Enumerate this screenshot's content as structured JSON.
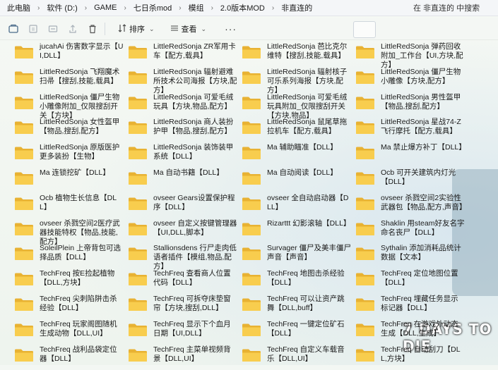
{
  "address_bar": {
    "crumbs": [
      "此电脑",
      "软件 (D:)",
      "GAME",
      "七日杀mod",
      "模组",
      "2.0版本MOD",
      "非直连的"
    ],
    "search_placeholder": "在 非直连的 中搜索"
  },
  "toolbar": {
    "sort_label": "排序",
    "view_label": "查看",
    "more_label": "···"
  },
  "background": {
    "logo_text": "7 DAYS TO DIE"
  },
  "folders": [
    "jucahAi 伤害数字显示【UI,DLL】",
    "LittleRedSonja ZR军用卡车【配方,载具】",
    "LittleRedSonja 芭比克尔维特【搜刮,技能,载具】",
    "LittleRedSonja 弹药回收附加_工作台【UI,方块,配方】",
    "LittleRedSonja 飞翔魔术扫帚【搜刮,技能,载具】",
    "LittleRedSonja 辐射避难所技术公司海报【方块,配方】",
    "LittleRedSonja 辐射核子可乐系列海报【方块,配方】",
    "LittleRedSonja 僵尸生物小雕像【方块,配方】",
    "LittleRedSonja 僵尸生物小雕像附加_仅限搜刮开关【方块】",
    "LittleRedSonja 可爱毛绒玩具【方块,物品,配方】",
    "LittleRedSonja 可爱毛绒玩具附加_仅限搜刮开关【方块,物品】",
    "LittleRedSonja 男性盔甲【物品,搜刮,配方】",
    "LittleRedSonja 女性盔甲【物品,搜刮,配方】",
    "LittleRedSonja 商人装扮护甲【物品,搜刮,配方】",
    "LittleRedSonja 鼠尾草拖拉机车【配方,载具】",
    "LittleRedSonja 星战74-Z飞行摩托【配方,载具】",
    "LittleRedSonja 原版医护更多装扮【生物】",
    "LittleRedSonja 装饰装甲系统【DLL】",
    "Ma 辅助瞄准【DLL】",
    "Ma 禁止爆方补丁【DLL】",
    "Ma 连锁挖矿【DLL】",
    "Ma 自动书籍【DLL】",
    "Ma 自动阅读【DLL】",
    "Ocb 可开关建筑内灯光【DLL】",
    "Ocb 植物生长信息【DLL】",
    "ovseer Gears设置保护程序【DLL】",
    "ovseer 全自动启动器【DLL】",
    "ovseer 杀戮空间2实验性武器包【物品,配方,声音】",
    "ovseer 杀戮空间2医疗武器技能特权【物品,技能,配方】",
    "ovseer 自定义按键管理器【UI,DLL,脚本】",
    "Rizarttt 幻影滚轴【DLL】",
    "Shaklin 用steam好友名字命名丧尸【DLL】",
    "SoleilPlein 上帝背包可选择品质【DLL】",
    "Stallionsdens 行尸走肉低语者插件【模组,物品,配方】",
    "Survager 僵尸及美丰僵尸声音【声音】",
    "Sythalin 添加消耗品统计数据【文本】",
    "TechFreq 按E捡起植物【DLL,方块】",
    "TechFreq 查看商人位置代码【DLL】",
    "TechFreq 地图击杀经验【DLL】",
    "TechFreq 定位地图位置【DLL】",
    "TechFreq 尖刺陷阱击杀经验【DLL】",
    "TechFreq 可拆夺床垫窗帘【方块,搜刮,DLL】",
    "TechFreq 可以让资产跳舞【DLL,buff】",
    "TechFreq 埋藏任务显示标记器【DLL】",
    "TechFreq 玩家阁图随机生成动物【DLL,UI】",
    "TechFreq 显示下个血月日期【UI,DLL】",
    "TechFreq 一键定位矿石【DLL】",
    "TechFreq 在游戏外动态生成【DLL,生成】",
    "TechFreq 战利品袋定位器【DLL】",
    "TechFreq 主菜单视频背景【DLL,UI】",
    "TechFreq 自定义车载音乐【DLL,UI】",
    "TechFreq 自动刮刀【DLL,方块】"
  ]
}
